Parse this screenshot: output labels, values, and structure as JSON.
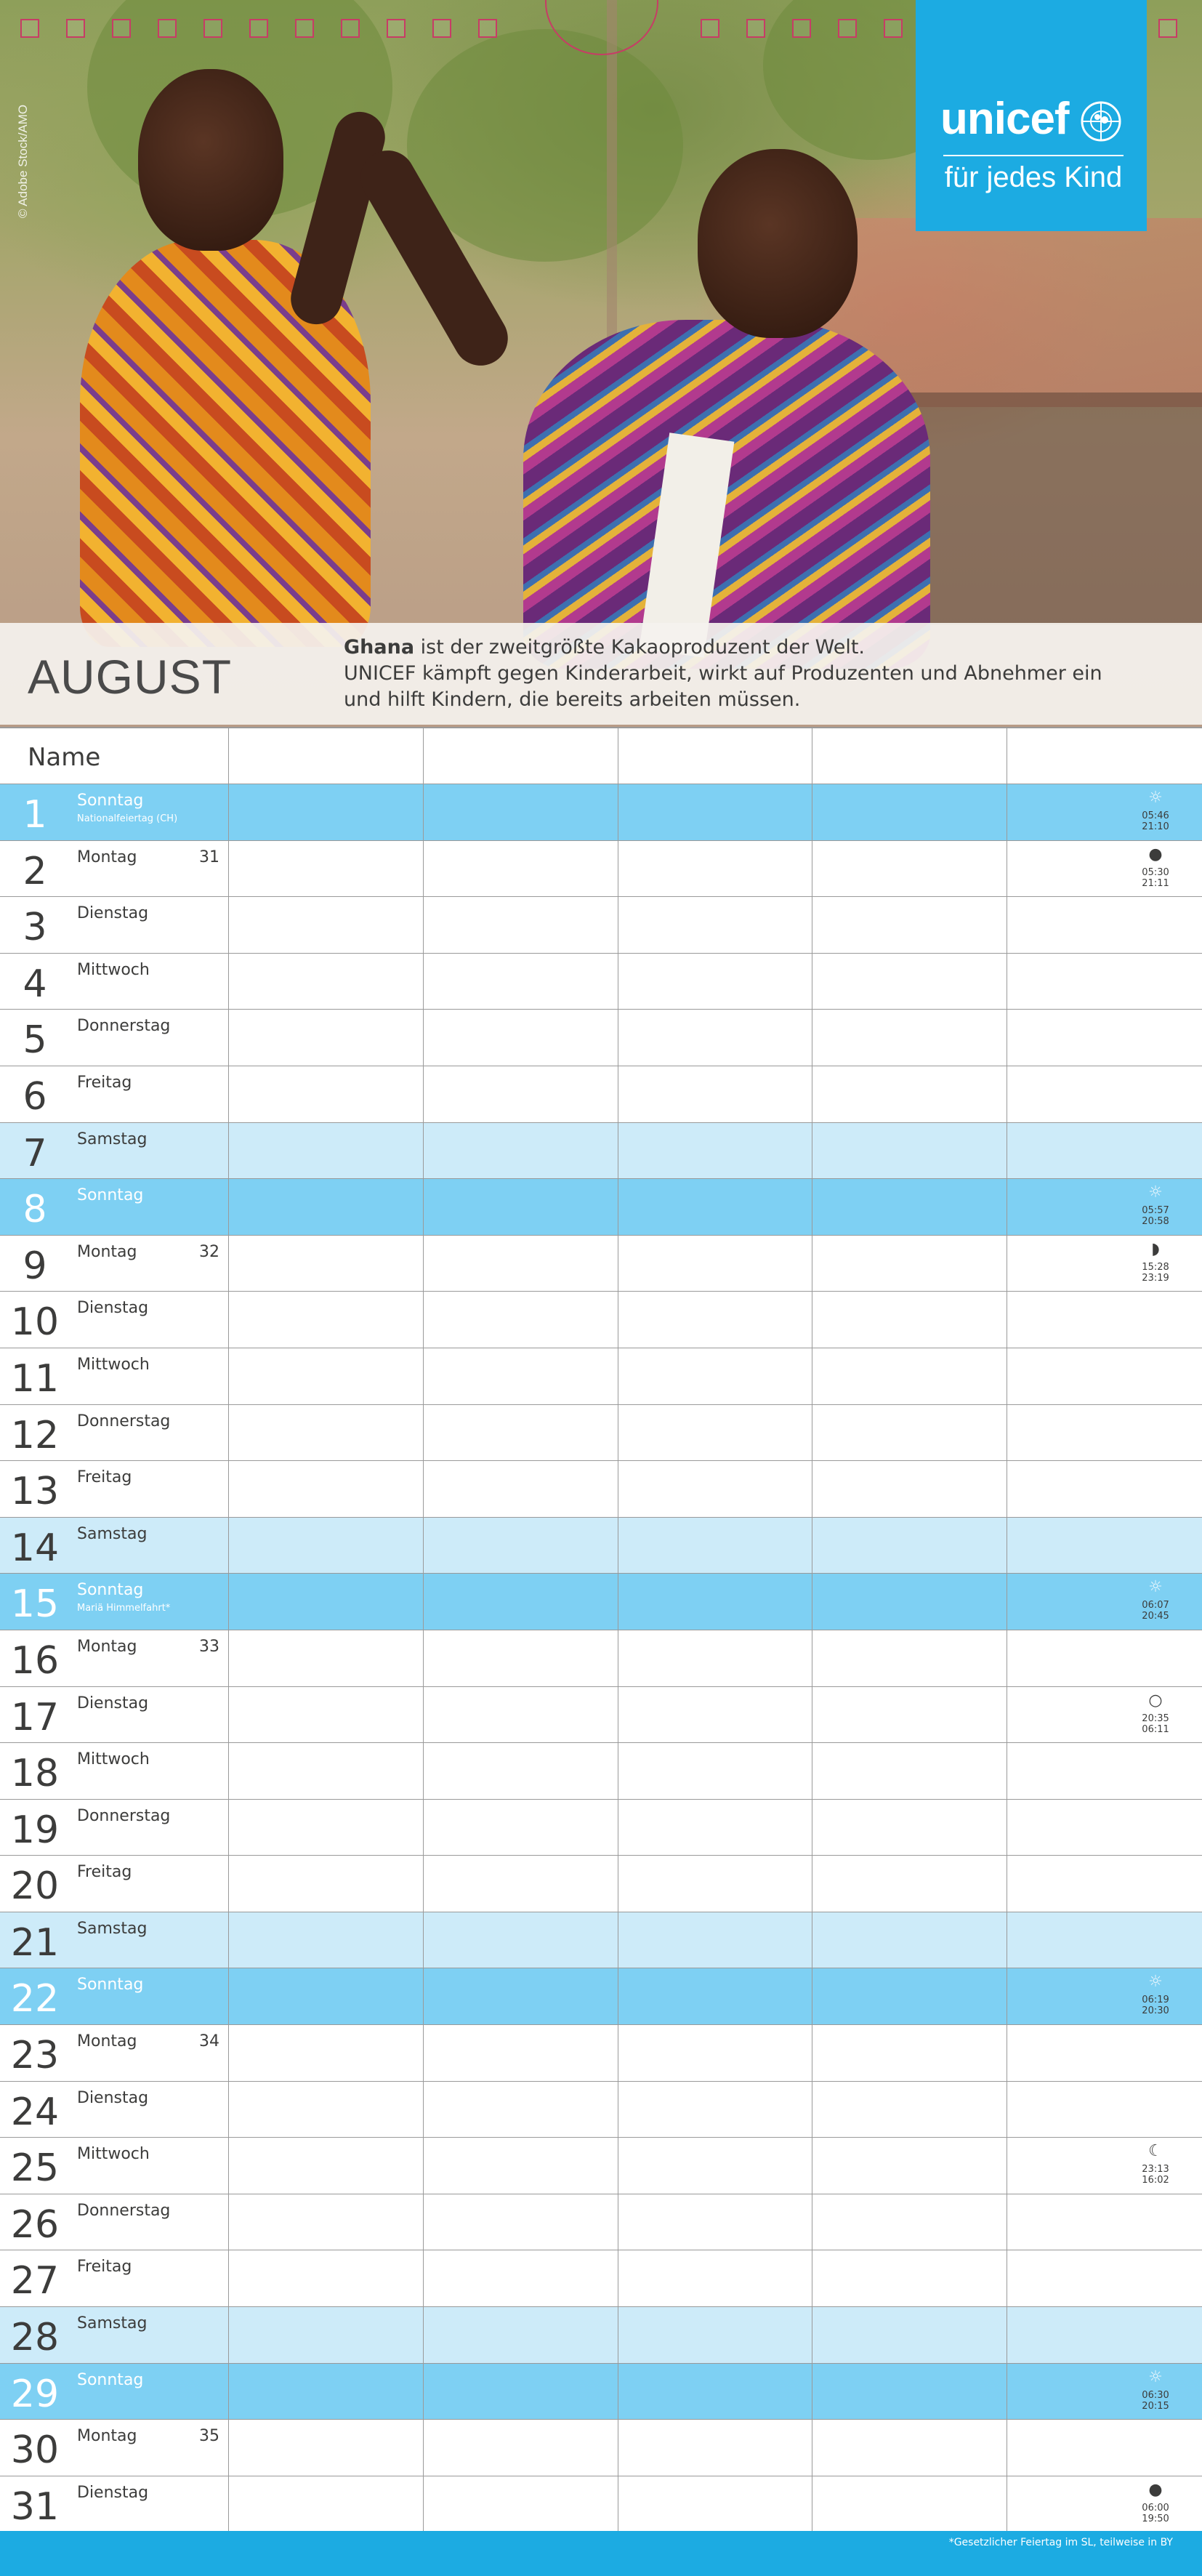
{
  "photo": {
    "credit": "© Adobe Stock/AMO"
  },
  "logo": {
    "word": "unicef",
    "tagline": "für jedes Kind",
    "color": "#1cabe2"
  },
  "header": {
    "month": "AUGUST",
    "blurb_bold": "Ghana",
    "blurb_line1": " ist der zweitgrößte Kakaoproduzent der Welt.",
    "blurb_line2": "UNICEF kämpft gegen Kinderarbeit, wirkt auf Produzenten und Abnehmer ein",
    "blurb_line3": "und hilft Kindern, die bereits arbeiten müssen."
  },
  "grid": {
    "name_label": "Name",
    "colors": {
      "saturday": "#cdebf9",
      "sunday": "#7ed0f3"
    },
    "days": [
      {
        "num": "1",
        "name": "Sonntag",
        "type": "sun",
        "holiday": "Nationalfeiertag (CH)",
        "week": "",
        "icon": "sun-icon",
        "sym": "☼",
        "t1": "05:46",
        "t2": "21:10"
      },
      {
        "num": "2",
        "name": "Montag",
        "type": "",
        "holiday": "",
        "week": "31",
        "icon": "new-moon-icon",
        "sym": "●",
        "t1": "05:30",
        "t2": "21:11"
      },
      {
        "num": "3",
        "name": "Dienstag",
        "type": "",
        "holiday": "",
        "week": "",
        "icon": "",
        "sym": "",
        "t1": "",
        "t2": ""
      },
      {
        "num": "4",
        "name": "Mittwoch",
        "type": "",
        "holiday": "",
        "week": "",
        "icon": "",
        "sym": "",
        "t1": "",
        "t2": ""
      },
      {
        "num": "5",
        "name": "Donnerstag",
        "type": "",
        "holiday": "",
        "week": "",
        "icon": "",
        "sym": "",
        "t1": "",
        "t2": ""
      },
      {
        "num": "6",
        "name": "Freitag",
        "type": "",
        "holiday": "",
        "week": "",
        "icon": "",
        "sym": "",
        "t1": "",
        "t2": ""
      },
      {
        "num": "7",
        "name": "Samstag",
        "type": "sat",
        "holiday": "",
        "week": "",
        "icon": "",
        "sym": "",
        "t1": "",
        "t2": ""
      },
      {
        "num": "8",
        "name": "Sonntag",
        "type": "sun",
        "holiday": "",
        "week": "",
        "icon": "sun-icon",
        "sym": "☼",
        "t1": "05:57",
        "t2": "20:58"
      },
      {
        "num": "9",
        "name": "Montag",
        "type": "",
        "holiday": "",
        "week": "32",
        "icon": "first-quarter-moon-icon",
        "sym": "◗",
        "t1": "15:28",
        "t2": "23:19"
      },
      {
        "num": "10",
        "name": "Dienstag",
        "type": "",
        "holiday": "",
        "week": "",
        "icon": "",
        "sym": "",
        "t1": "",
        "t2": ""
      },
      {
        "num": "11",
        "name": "Mittwoch",
        "type": "",
        "holiday": "",
        "week": "",
        "icon": "",
        "sym": "",
        "t1": "",
        "t2": ""
      },
      {
        "num": "12",
        "name": "Donnerstag",
        "type": "",
        "holiday": "",
        "week": "",
        "icon": "",
        "sym": "",
        "t1": "",
        "t2": ""
      },
      {
        "num": "13",
        "name": "Freitag",
        "type": "",
        "holiday": "",
        "week": "",
        "icon": "",
        "sym": "",
        "t1": "",
        "t2": ""
      },
      {
        "num": "14",
        "name": "Samstag",
        "type": "sat",
        "holiday": "",
        "week": "",
        "icon": "",
        "sym": "",
        "t1": "",
        "t2": ""
      },
      {
        "num": "15",
        "name": "Sonntag",
        "type": "sun",
        "holiday": "Mariä Himmelfahrt*",
        "week": "",
        "icon": "sun-icon",
        "sym": "☼",
        "t1": "06:07",
        "t2": "20:45"
      },
      {
        "num": "16",
        "name": "Montag",
        "type": "",
        "holiday": "",
        "week": "33",
        "icon": "",
        "sym": "",
        "t1": "",
        "t2": ""
      },
      {
        "num": "17",
        "name": "Dienstag",
        "type": "",
        "holiday": "",
        "week": "",
        "icon": "full-moon-icon",
        "sym": "○",
        "t1": "20:35",
        "t2": "06:11"
      },
      {
        "num": "18",
        "name": "Mittwoch",
        "type": "",
        "holiday": "",
        "week": "",
        "icon": "",
        "sym": "",
        "t1": "",
        "t2": ""
      },
      {
        "num": "19",
        "name": "Donnerstag",
        "type": "",
        "holiday": "",
        "week": "",
        "icon": "",
        "sym": "",
        "t1": "",
        "t2": ""
      },
      {
        "num": "20",
        "name": "Freitag",
        "type": "",
        "holiday": "",
        "week": "",
        "icon": "",
        "sym": "",
        "t1": "",
        "t2": ""
      },
      {
        "num": "21",
        "name": "Samstag",
        "type": "sat",
        "holiday": "",
        "week": "",
        "icon": "",
        "sym": "",
        "t1": "",
        "t2": ""
      },
      {
        "num": "22",
        "name": "Sonntag",
        "type": "sun",
        "holiday": "",
        "week": "",
        "icon": "sun-icon",
        "sym": "☼",
        "t1": "06:19",
        "t2": "20:30"
      },
      {
        "num": "23",
        "name": "Montag",
        "type": "",
        "holiday": "",
        "week": "34",
        "icon": "",
        "sym": "",
        "t1": "",
        "t2": ""
      },
      {
        "num": "24",
        "name": "Dienstag",
        "type": "",
        "holiday": "",
        "week": "",
        "icon": "",
        "sym": "",
        "t1": "",
        "t2": ""
      },
      {
        "num": "25",
        "name": "Mittwoch",
        "type": "",
        "holiday": "",
        "week": "",
        "icon": "last-quarter-moon-icon",
        "sym": "☾",
        "t1": "23:13",
        "t2": "16:02"
      },
      {
        "num": "26",
        "name": "Donnerstag",
        "type": "",
        "holiday": "",
        "week": "",
        "icon": "",
        "sym": "",
        "t1": "",
        "t2": ""
      },
      {
        "num": "27",
        "name": "Freitag",
        "type": "",
        "holiday": "",
        "week": "",
        "icon": "",
        "sym": "",
        "t1": "",
        "t2": ""
      },
      {
        "num": "28",
        "name": "Samstag",
        "type": "sat",
        "holiday": "",
        "week": "",
        "icon": "",
        "sym": "",
        "t1": "",
        "t2": ""
      },
      {
        "num": "29",
        "name": "Sonntag",
        "type": "sun",
        "holiday": "",
        "week": "",
        "icon": "sun-icon",
        "sym": "☼",
        "t1": "06:30",
        "t2": "20:15"
      },
      {
        "num": "30",
        "name": "Montag",
        "type": "",
        "holiday": "",
        "week": "35",
        "icon": "",
        "sym": "",
        "t1": "",
        "t2": ""
      },
      {
        "num": "31",
        "name": "Dienstag",
        "type": "",
        "holiday": "",
        "week": "",
        "icon": "new-moon-icon",
        "sym": "●",
        "t1": "06:00",
        "t2": "19:50"
      }
    ]
  },
  "footer": {
    "note": "*Gesetzlicher Feiertag im SL, teilweise in BY"
  }
}
